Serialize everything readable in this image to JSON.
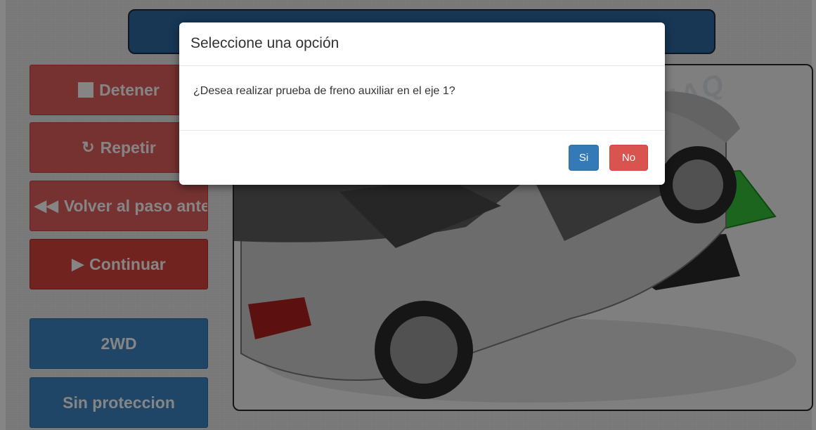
{
  "sidebar": {
    "buttons": [
      {
        "label": "Detener",
        "icon": "stop-icon"
      },
      {
        "label": "Repetir",
        "icon": "refresh-icon"
      },
      {
        "label": "Volver al paso anterior",
        "icon": "backward-icon"
      },
      {
        "label": "Continuar",
        "icon": "play-icon"
      },
      {
        "label": "2WD"
      },
      {
        "label": "Sin proteccion"
      }
    ]
  },
  "watermark": {
    "text": "TECNIMAQ"
  },
  "dialog": {
    "title": "Seleccione una opción",
    "message": "¿Desea realizar prueba de freno auxiliar en el eje 1?",
    "yes_label": "Si",
    "no_label": "No"
  },
  "colors": {
    "danger": "#d9534f",
    "primary": "#337ab7",
    "header_blue": "#2d6aa3",
    "plate_green": "#37c23a"
  }
}
